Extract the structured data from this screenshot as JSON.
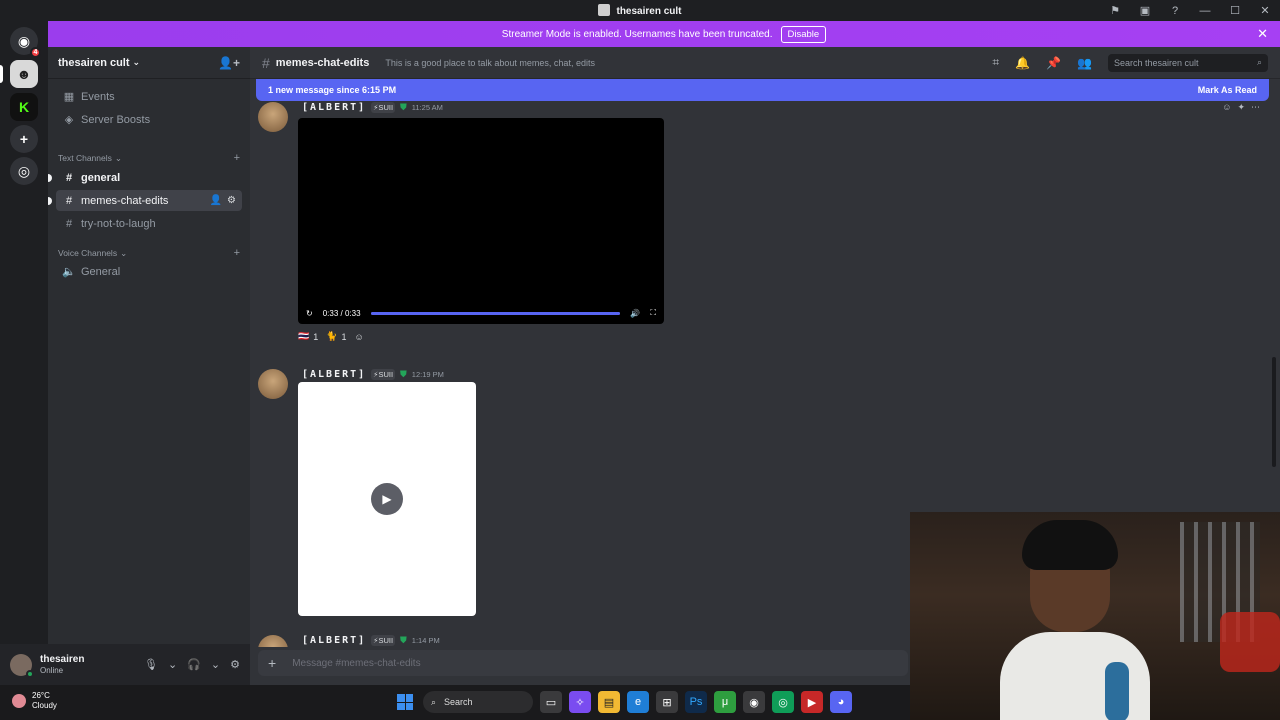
{
  "window": {
    "title": "thesairen cult",
    "controls": [
      "flag-icon",
      "inbox-icon",
      "help-icon",
      "minimize-icon",
      "maximize-icon",
      "close-icon"
    ]
  },
  "guilds": [
    {
      "name": "discord-home",
      "badge": "4",
      "color": "#5865f2"
    },
    {
      "name": "server-thesairen",
      "color": "#d9d9d9"
    },
    {
      "name": "server-kick",
      "color": "#53fc18"
    },
    {
      "name": "add-server",
      "color": "#313338"
    },
    {
      "name": "discover",
      "color": "#313338"
    }
  ],
  "banner": {
    "text": "Streamer Mode is enabled. Usernames have been truncated.",
    "button": "Disable"
  },
  "server": {
    "name": "thesairen cult",
    "items": [
      {
        "label": "Events",
        "icon": "calendar-icon"
      },
      {
        "label": "Server Boosts",
        "icon": "boost-icon"
      }
    ],
    "categories": [
      {
        "label": "Text Channels",
        "channels": [
          {
            "label": "general",
            "state": "unread"
          },
          {
            "label": "memes-chat-edits",
            "state": "active"
          },
          {
            "label": "try-not-to-laugh",
            "state": "normal"
          }
        ]
      },
      {
        "label": "Voice Channels",
        "channels": [
          {
            "label": "General",
            "state": "voice"
          }
        ]
      }
    ]
  },
  "user": {
    "name": "thesairen",
    "status": "Online"
  },
  "channel": {
    "name": "memes-chat-edits",
    "topic": "This is a good place to talk about memes, chat, edits",
    "search_placeholder": "Search thesairen cult"
  },
  "new_messages": {
    "text": "1 new message since 6:15 PM",
    "action": "Mark As Read"
  },
  "messages": [
    {
      "author": "[ALBERT]",
      "tag": "⚡SUII",
      "time": "11:25 AM",
      "video": {
        "time": "0:33 / 0:33",
        "progress": 1.0
      },
      "reactions": [
        {
          "emoji": "🇹🇭",
          "count": "1"
        },
        {
          "emoji": "🐈",
          "count": "1"
        }
      ]
    },
    {
      "author": "[ALBERT]",
      "tag": "⚡SUII",
      "time": "12:19 PM"
    },
    {
      "author": "[ALBERT]",
      "tag": "⚡SUII",
      "time": "1:14 PM"
    }
  ],
  "composer": {
    "placeholder": "Message #memes-chat-edits"
  },
  "taskbar": {
    "weather_temp": "26°C",
    "weather_desc": "Cloudy",
    "search_label": "Search"
  }
}
